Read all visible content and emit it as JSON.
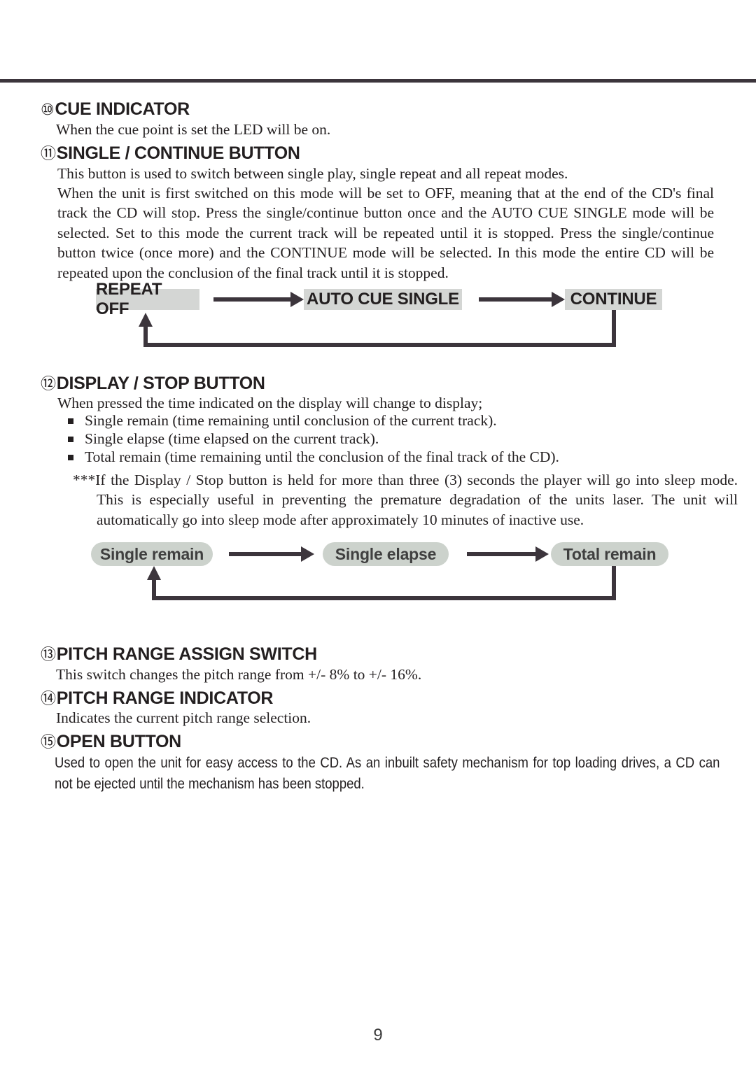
{
  "page": {
    "number": "9"
  },
  "sections": [
    {
      "marker": "⑩",
      "title": "CUE INDICATOR",
      "paragraphs": [
        "When the cue point is set the LED will be on."
      ]
    },
    {
      "marker": "⑪",
      "title": "SINGLE / CONTINUE BUTTON",
      "paragraphs": [
        "This button is used to switch between single play, single repeat and all repeat modes.",
        "When the unit is first switched on this mode will be set to OFF, meaning that at the end of the CD's final track the CD will stop. Press the single/continue button once and the AUTO CUE SINGLE mode will be selected. Set to this mode the current track will be repeated until it is stopped.  Press the single/continue button twice (once more) and the CONTINUE mode will be selected. In this mode the entire CD will be repeated upon the conclusion of the final track until it is stopped."
      ]
    },
    {
      "marker": "⑫",
      "title": "DISPLAY / STOP BUTTON",
      "paragraphs": [
        "When pressed the time indicated on the display will change to display;"
      ],
      "bullets": [
        "Single remain (time remaining until conclusion of the current track).",
        "Single elapse (time elapsed on the current track).",
        "Total remain (time remaining until the conclusion of the final track of the CD)."
      ],
      "note": "***If the Display / Stop button is held for more than three (3) seconds the player will go into sleep mode.  This is especially useful in preventing the premature degradation of the units laser.  The unit will automatically go into sleep mode after approximately 10 minutes of inactive use."
    },
    {
      "marker": "⑬",
      "title": "PITCH RANGE ASSIGN SWITCH",
      "paragraphs": [
        "This switch changes the pitch range from +/- 8% to +/- 16%."
      ]
    },
    {
      "marker": "⑭",
      "title": "PITCH RANGE INDICATOR",
      "paragraphs": [
        "Indicates the current pitch range selection."
      ]
    },
    {
      "marker": "⑮",
      "title": "OPEN BUTTON",
      "paragraphs": [
        "Used to open the unit for easy access to the CD.  As an inbuilt safety mechanism for top loading drives, a CD can not be ejected until the mechanism has been stopped."
      ]
    }
  ],
  "diagrams": [
    {
      "id": "repeat-mode-cycle",
      "style": "sharp",
      "fill_color": "#d4d6d4",
      "text_color": "#231f20",
      "arrow_color": "#3c353c",
      "nodes": [
        {
          "label": "REPEAT OFF"
        },
        {
          "label": "AUTO CUE SINGLE"
        },
        {
          "label": "CONTINUE"
        }
      ],
      "loop_back": true
    },
    {
      "id": "time-display-cycle",
      "style": "pill",
      "fill_color": "#ccd2cc",
      "text_color": "#3f3f3f",
      "arrow_color": "#3c353c",
      "nodes": [
        {
          "label": "Single remain"
        },
        {
          "label": "Single elapse"
        },
        {
          "label": "Total remain"
        }
      ],
      "loop_back": true
    }
  ]
}
